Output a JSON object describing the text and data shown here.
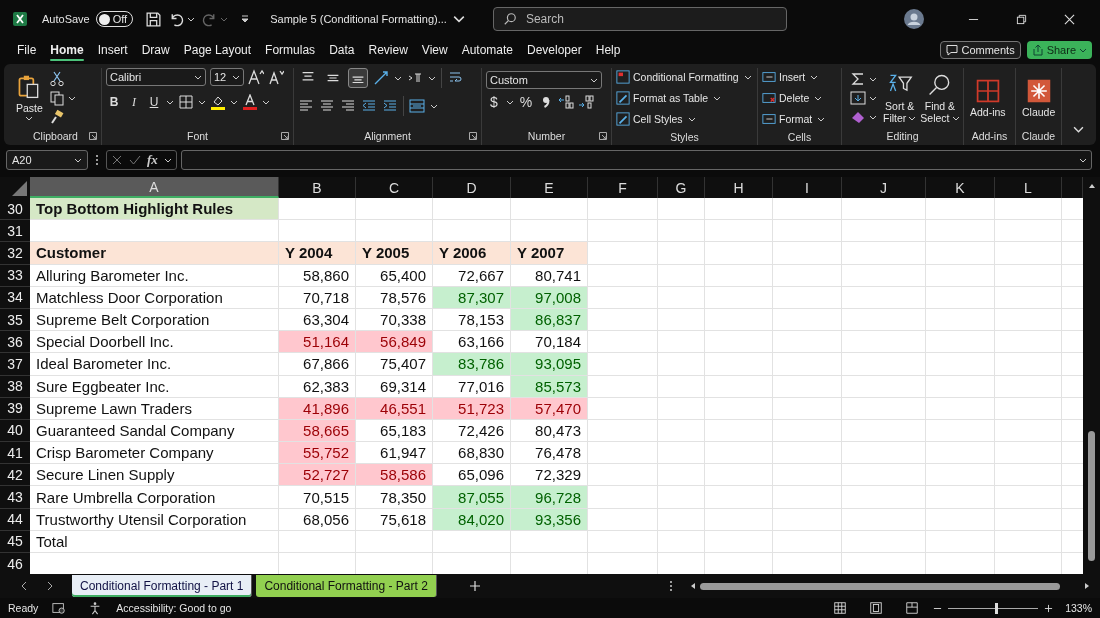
{
  "titlebar": {
    "autosave_label": "AutoSave",
    "autosave": {
      "on": false,
      "label": "Off"
    },
    "doc_title": "Sample 5 (Conditional Formatting)...",
    "search_placeholder": "Search"
  },
  "menu_tabs": [
    {
      "label": "File",
      "selected": false
    },
    {
      "label": "Home",
      "selected": true
    },
    {
      "label": "Insert",
      "selected": false
    },
    {
      "label": "Draw",
      "selected": false
    },
    {
      "label": "Page Layout",
      "selected": false
    },
    {
      "label": "Formulas",
      "selected": false
    },
    {
      "label": "Data",
      "selected": false
    },
    {
      "label": "Review",
      "selected": false
    },
    {
      "label": "View",
      "selected": false
    },
    {
      "label": "Automate",
      "selected": false
    },
    {
      "label": "Developer",
      "selected": false
    },
    {
      "label": "Help",
      "selected": false
    }
  ],
  "actions": {
    "comments": "Comments",
    "share": "Share"
  },
  "ribbon": {
    "clipboard": {
      "label": "Clipboard",
      "paste": "Paste"
    },
    "font": {
      "label": "Font",
      "font_name": "Calibri",
      "font_size": "12",
      "style_buttons": [
        "B",
        "I",
        "U"
      ]
    },
    "alignment": {
      "label": "Alignment",
      "vertical_align": [
        {
          "selected": false
        },
        {
          "selected": false
        },
        {
          "selected": true
        }
      ]
    },
    "number": {
      "label": "Number",
      "format": "Custom",
      "currency": "$",
      "percent": "%"
    },
    "styles": {
      "label": "Styles",
      "items": [
        "Conditional Formatting",
        "Format as Table",
        "Cell Styles"
      ]
    },
    "cells": {
      "label": "Cells",
      "items": [
        "Insert",
        "Delete",
        "Format"
      ]
    },
    "editing": {
      "label": "Editing",
      "sort": [
        "Sort &",
        "Filter"
      ],
      "find": [
        "Find &",
        "Select"
      ]
    },
    "addins": {
      "label": "Add-ins",
      "button": "Add-ins"
    },
    "claude": {
      "label": "Claude",
      "button": "Claude"
    }
  },
  "formula_bar": {
    "name_box": "A20",
    "fx": "fx"
  },
  "sheet": {
    "columns": [
      {
        "label": "A",
        "selected": true
      },
      {
        "label": "B",
        "selected": false
      },
      {
        "label": "C",
        "selected": false
      },
      {
        "label": "D",
        "selected": false
      },
      {
        "label": "E",
        "selected": false
      },
      {
        "label": "F",
        "selected": false
      },
      {
        "label": "G",
        "selected": false
      },
      {
        "label": "H",
        "selected": false
      },
      {
        "label": "I",
        "selected": false
      },
      {
        "label": "J",
        "selected": false
      },
      {
        "label": "K",
        "selected": false
      },
      {
        "label": "L",
        "selected": false
      }
    ],
    "rows": [
      {
        "num": "30",
        "kind": "title",
        "cells": [
          "Top Bottom Highlight Rules"
        ]
      },
      {
        "num": "31",
        "kind": "blank"
      },
      {
        "num": "32",
        "kind": "header",
        "cells": [
          "Customer",
          "Y 2004",
          "Y 2005",
          "Y 2006",
          "Y 2007"
        ]
      },
      {
        "num": "33",
        "kind": "data",
        "customer": "Alluring Barometer Inc.",
        "values": [
          {
            "text": "58,860",
            "top": false,
            "bottom": false
          },
          {
            "text": "65,400",
            "top": false,
            "bottom": false
          },
          {
            "text": "72,667",
            "top": false,
            "bottom": false
          },
          {
            "text": "80,741",
            "top": false,
            "bottom": false
          }
        ]
      },
      {
        "num": "34",
        "kind": "data",
        "customer": "Matchless Door Corporation",
        "values": [
          {
            "text": "70,718",
            "top": false,
            "bottom": false
          },
          {
            "text": "78,576",
            "top": false,
            "bottom": false
          },
          {
            "text": "87,307",
            "top": true,
            "bottom": false
          },
          {
            "text": "97,008",
            "top": true,
            "bottom": false
          }
        ]
      },
      {
        "num": "35",
        "kind": "data",
        "customer": "Supreme Belt Corporation",
        "values": [
          {
            "text": "63,304",
            "top": false,
            "bottom": false
          },
          {
            "text": "70,338",
            "top": false,
            "bottom": false
          },
          {
            "text": "78,153",
            "top": false,
            "bottom": false
          },
          {
            "text": "86,837",
            "top": true,
            "bottom": false
          }
        ]
      },
      {
        "num": "36",
        "kind": "data",
        "customer": "Special Doorbell Inc.",
        "values": [
          {
            "text": "51,164",
            "top": false,
            "bottom": true
          },
          {
            "text": "56,849",
            "top": false,
            "bottom": true
          },
          {
            "text": "63,166",
            "top": false,
            "bottom": false
          },
          {
            "text": "70,184",
            "top": false,
            "bottom": false
          }
        ]
      },
      {
        "num": "37",
        "kind": "data",
        "customer": "Ideal Barometer Inc.",
        "values": [
          {
            "text": "67,866",
            "top": false,
            "bottom": false
          },
          {
            "text": "75,407",
            "top": false,
            "bottom": false
          },
          {
            "text": "83,786",
            "top": true,
            "bottom": false
          },
          {
            "text": "93,095",
            "top": true,
            "bottom": false
          }
        ]
      },
      {
        "num": "38",
        "kind": "data",
        "customer": "Sure Eggbeater Inc.",
        "values": [
          {
            "text": "62,383",
            "top": false,
            "bottom": false
          },
          {
            "text": "69,314",
            "top": false,
            "bottom": false
          },
          {
            "text": "77,016",
            "top": false,
            "bottom": false
          },
          {
            "text": "85,573",
            "top": true,
            "bottom": false
          }
        ]
      },
      {
        "num": "39",
        "kind": "data",
        "customer": "Supreme Lawn Traders",
        "values": [
          {
            "text": "41,896",
            "top": false,
            "bottom": true
          },
          {
            "text": "46,551",
            "top": false,
            "bottom": true
          },
          {
            "text": "51,723",
            "top": false,
            "bottom": true
          },
          {
            "text": "57,470",
            "top": false,
            "bottom": true
          }
        ]
      },
      {
        "num": "40",
        "kind": "data",
        "customer": "Guaranteed Sandal Company",
        "values": [
          {
            "text": "58,665",
            "top": false,
            "bottom": true
          },
          {
            "text": "65,183",
            "top": false,
            "bottom": false
          },
          {
            "text": "72,426",
            "top": false,
            "bottom": false
          },
          {
            "text": "80,473",
            "top": false,
            "bottom": false
          }
        ]
      },
      {
        "num": "41",
        "kind": "data",
        "customer": "Crisp Barometer Company",
        "values": [
          {
            "text": "55,752",
            "top": false,
            "bottom": true
          },
          {
            "text": "61,947",
            "top": false,
            "bottom": false
          },
          {
            "text": "68,830",
            "top": false,
            "bottom": false
          },
          {
            "text": "76,478",
            "top": false,
            "bottom": false
          }
        ]
      },
      {
        "num": "42",
        "kind": "data",
        "customer": "Secure Linen Supply",
        "values": [
          {
            "text": "52,727",
            "top": false,
            "bottom": true
          },
          {
            "text": "58,586",
            "top": false,
            "bottom": true
          },
          {
            "text": "65,096",
            "top": false,
            "bottom": false
          },
          {
            "text": "72,329",
            "top": false,
            "bottom": false
          }
        ]
      },
      {
        "num": "43",
        "kind": "data",
        "customer": "Rare Umbrella Corporation",
        "values": [
          {
            "text": "70,515",
            "top": false,
            "bottom": false
          },
          {
            "text": "78,350",
            "top": false,
            "bottom": false
          },
          {
            "text": "87,055",
            "top": true,
            "bottom": false
          },
          {
            "text": "96,728",
            "top": true,
            "bottom": false
          }
        ]
      },
      {
        "num": "44",
        "kind": "data",
        "customer": "Trustworthy Utensil Corporation",
        "values": [
          {
            "text": "68,056",
            "top": false,
            "bottom": false
          },
          {
            "text": "75,618",
            "top": false,
            "bottom": false
          },
          {
            "text": "84,020",
            "top": true,
            "bottom": false
          },
          {
            "text": "93,356",
            "top": true,
            "bottom": false
          }
        ]
      },
      {
        "num": "45",
        "kind": "total",
        "cells": [
          "Total"
        ]
      },
      {
        "num": "46",
        "kind": "blank"
      }
    ]
  },
  "sheet_tabs": [
    {
      "label": "Conditional Formatting - Part 1",
      "selected": true
    },
    {
      "label": "Conditional Formatting - Part 2",
      "selected": false,
      "color": "#92d050"
    }
  ],
  "status_bar": {
    "ready": "Ready",
    "accessibility": "Accessibility: Good to go",
    "zoom_slider": {
      "level": 0.53
    },
    "zoom": "133%"
  }
}
